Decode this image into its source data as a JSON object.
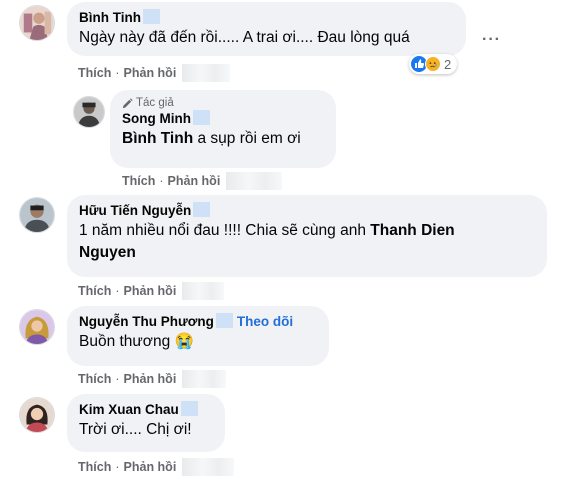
{
  "comments": [
    {
      "author": "Bình Tinh",
      "text": "Ngày này đã đến rồi..... A trai ơi.... Đau lòng quá",
      "like": "Thích",
      "reply": "Phản hồi",
      "reaction_count": "2",
      "reaction_icons": [
        "like-icon",
        "sad-icon"
      ]
    },
    {
      "author_badge": "Tác giả",
      "author": "Song Minh",
      "mention": "Bình Tinh",
      "text": " a sụp rồi em ơi",
      "like": "Thích",
      "reply": "Phản hồi"
    },
    {
      "author": "Hữu Tiến Nguyễn",
      "text_line1": "1 năm nhiều nổi đau !!!! Chia sẽ cùng anh ",
      "mention_part1": "Thanh Dien",
      "mention_part2": "Nguyen",
      "like": "Thích",
      "reply": "Phản hồi"
    },
    {
      "author": "Nguyễn Thu Phương",
      "follow": "Theo dõi",
      "text": "Buồn thương ",
      "emoji": "😭",
      "like": "Thích",
      "reply": "Phản hồi"
    },
    {
      "author": "Kim Xuan Chau",
      "text": "Trời ơi.... Chị ơi!",
      "like": "Thích",
      "reply": "Phản hồi"
    }
  ],
  "more_options": "···",
  "colors": {
    "bubble": "#f0f2f5",
    "action_text": "#65676b",
    "link": "#216fdb",
    "like_blue": "#1877f2",
    "sad_yellow": "#f7b125"
  }
}
